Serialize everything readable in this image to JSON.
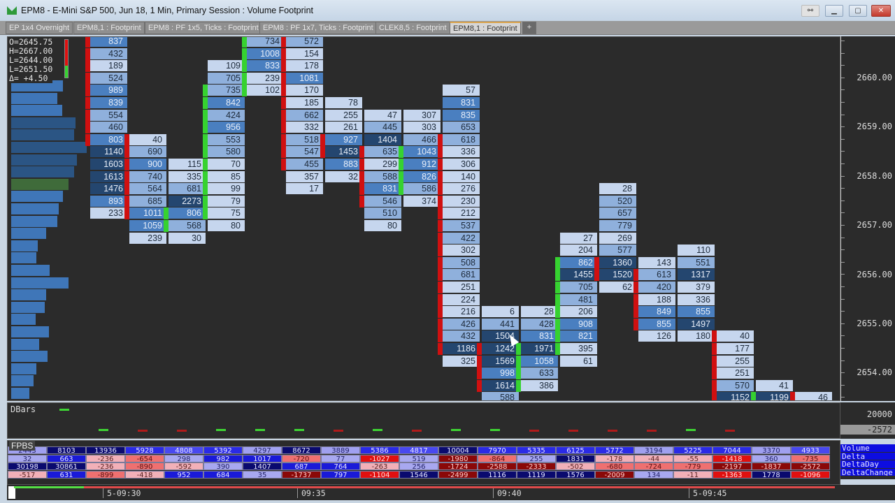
{
  "window": {
    "title": "EPM8 - E-Mini S&P 500, Jun 18, 1 Min, Primary Session : Volume Footprint",
    "buttons": [
      "link",
      "minimize",
      "maximize",
      "close"
    ]
  },
  "tabs": [
    {
      "label": "EP 1x4 Overnight",
      "active": false
    },
    {
      "label": "EPM8,1 : Footprint",
      "active": false
    },
    {
      "label": "EPM8 : PF 1x5, Ticks : Footprint",
      "active": false
    },
    {
      "label": "EPM8 : PF 1x7, Ticks : Footprint",
      "active": false
    },
    {
      "label": "CLEK8,5 : Footprint",
      "active": false
    },
    {
      "label": "EPM8,1 : Footprint",
      "active": true
    },
    {
      "label": "+",
      "active": false
    }
  ],
  "ohlc": {
    "open": "O=2645.75",
    "high": "H=2667.00",
    "low": "L=2644.00",
    "last": "L=2651.50",
    "change": "Δ=  +4.50"
  },
  "price_axis": [
    "2660.00",
    "2659.00",
    "2658.00",
    "2657.00",
    "2656.00",
    "2655.00",
    "2654.00"
  ],
  "colors": {
    "bg": "#2b2b2b",
    "up_marker": "#36d230",
    "down_marker": "#d01010",
    "cell_light": "#c6d6ee",
    "cell_mid": "#8fb0dc",
    "cell_blue": "#4a7fc0",
    "cell_dark": "#24466f"
  },
  "footprint": {
    "columns": [
      {
        "startRow": 0,
        "values": [
          837,
          432,
          189,
          524,
          989,
          839,
          554,
          460,
          803,
          1140,
          1603,
          1613,
          1476,
          893,
          233
        ],
        "marks": {
          "0": "down",
          "1": "down",
          "2": "down",
          "3": "down",
          "4": "down",
          "5": "down",
          "6": "down",
          "7": "down",
          "8": "down"
        }
      },
      {
        "startRow": 8,
        "values": [
          40,
          690,
          900,
          740,
          564,
          685,
          1011,
          1059,
          239
        ],
        "marks": {
          "8": "down",
          "9": "down",
          "10": "down",
          "11": "down",
          "12": "down",
          "13": "down",
          "14": "down"
        }
      },
      {
        "startRow": 10,
        "values": [
          115,
          335,
          681,
          2273,
          806,
          568,
          30
        ],
        "marks": {
          "14": "up",
          "15": "up"
        }
      },
      {
        "startRow": 2,
        "values": [
          109,
          705,
          735,
          842,
          424,
          956,
          553,
          580,
          70,
          85,
          99,
          79,
          75,
          80
        ],
        "marks": {
          "4": "up",
          "5": "up",
          "6": "up",
          "7": "up",
          "8": "up",
          "9": "up",
          "10": "up",
          "11": "up",
          "12": "up",
          "13": "up",
          "14": "up"
        }
      },
      {
        "startRow": 0,
        "values": [
          734,
          1008,
          833,
          239,
          102
        ],
        "marks": {
          "0": "up",
          "1": "up",
          "2": "up",
          "3": "up",
          "4": "up"
        }
      },
      {
        "startRow": 0,
        "values": [
          572,
          154,
          178,
          1081,
          170,
          185,
          662,
          332,
          518,
          547,
          455,
          357,
          17
        ],
        "marks": {
          "0": "down",
          "1": "down",
          "2": "down",
          "3": "down",
          "4": "down",
          "5": "down",
          "6": "down",
          "7": "down",
          "8": "down",
          "9": "down",
          "10": "down"
        }
      },
      {
        "startRow": 5,
        "values": [
          78,
          255,
          261,
          927,
          1453,
          883,
          32
        ],
        "marks": {
          "8": "down",
          "9": "down"
        }
      },
      {
        "startRow": 6,
        "values": [
          47,
          445,
          1404,
          635,
          299,
          588,
          831,
          546,
          510,
          80
        ],
        "marks": {
          "9": "down",
          "10": "down",
          "11": "down",
          "12": "down",
          "13": "down"
        }
      },
      {
        "startRow": 6,
        "values": [
          307,
          303,
          466,
          1043,
          912,
          826,
          586,
          374
        ],
        "marks": {
          "9": "up",
          "10": "up",
          "11": "up",
          "12": "up"
        }
      },
      {
        "startRow": 4,
        "values": [
          57,
          831,
          835,
          653,
          618,
          336,
          306,
          140,
          276,
          230,
          212,
          537,
          422,
          302,
          508,
          681,
          251,
          224,
          216,
          426,
          432,
          1186,
          325
        ],
        "marks": {
          "8": "down",
          "9": "down",
          "10": "down",
          "11": "down",
          "12": "down",
          "13": "down",
          "14": "down",
          "15": "down",
          "16": "down",
          "17": "down",
          "18": "down",
          "19": "down",
          "20": "down",
          "21": "down",
          "22": "down",
          "23": "down",
          "24": "down",
          "25": "down"
        }
      },
      {
        "startRow": 22,
        "values": [
          6,
          441,
          1504,
          1242,
          1569,
          998,
          1614,
          588
        ],
        "marks": {
          "25": "down",
          "26": "down",
          "27": "down",
          "28": "down"
        }
      },
      {
        "startRow": 22,
        "values": [
          28,
          428,
          831,
          1971,
          1058,
          633,
          386
        ],
        "marks": {
          "25": "up",
          "26": "up",
          "27": "up",
          "28": "up"
        }
      },
      {
        "startRow": 16,
        "values": [
          27,
          204,
          862,
          1455,
          705,
          481,
          206,
          908,
          821,
          395,
          61
        ],
        "marks": {
          "18": "up",
          "19": "up",
          "20": "up",
          "21": "up",
          "22": "up",
          "23": "up",
          "24": "up",
          "25": "up"
        }
      },
      {
        "startRow": 12,
        "values": [
          28,
          520,
          657,
          779,
          269,
          577,
          1360,
          1520,
          62
        ],
        "marks": {
          "18": "down",
          "19": "down"
        }
      },
      {
        "startRow": 18,
        "values": [
          143,
          613,
          420,
          188,
          849,
          855,
          126
        ],
        "marks": {
          "19": "down",
          "20": "down",
          "21": "down",
          "22": "down",
          "23": "down"
        }
      },
      {
        "startRow": 17,
        "values": [
          110,
          551,
          1317,
          379,
          336,
          855,
          1497,
          180
        ],
        "marks": {}
      },
      {
        "startRow": 24,
        "values": [
          40,
          177,
          255,
          251,
          570,
          1152
        ],
        "marks": {
          "24": "down",
          "25": "down",
          "26": "down",
          "27": "down",
          "28": "down",
          "29": "down"
        }
      },
      {
        "startRow": 28,
        "values": [
          41,
          1199
        ],
        "marks": {
          "29": "up"
        }
      },
      {
        "startRow": 29,
        "values": [
          46
        ],
        "marks": {
          "29": "down"
        }
      }
    ]
  },
  "volume_profile": [
    0.62,
    0.55,
    0.61,
    0.77,
    0.75,
    0.9,
    0.78,
    0.75,
    0.68,
    0.62,
    0.57,
    0.55,
    0.42,
    0.32,
    0.3,
    0.46,
    0.68,
    0.42,
    0.4,
    0.29,
    0.45,
    0.33,
    0.43,
    0.3,
    0.27,
    0.22
  ],
  "dbars": {
    "title": "DBars",
    "axis_top": "20000",
    "axis_current": "-2572",
    "bars": [
      "up",
      "down",
      "down",
      "up",
      "up",
      "up",
      "down",
      "up",
      "down",
      "up",
      "up",
      "down",
      "down",
      "down",
      "down",
      "up",
      "down"
    ]
  },
  "fpbs": {
    "title": "FPBS",
    "legend": [
      "Volume",
      "Delta",
      "DeltaDay",
      "DeltaChange"
    ],
    "volume": [
      2443,
      8103,
      13936,
      5928,
      4808,
      5392,
      4297,
      8672,
      3889,
      5386,
      4817,
      10004,
      7970,
      5335,
      6125,
      5772,
      3194,
      5225,
      7044,
      3370,
      4933
    ],
    "delta": [
      32,
      663,
      -236,
      -654,
      298,
      982,
      1017,
      -720,
      77,
      -1027,
      519,
      -1980,
      -864,
      255,
      1831,
      -178,
      -44,
      -55,
      -1418,
      360,
      -735
    ],
    "delta_day": [
      30198,
      30861,
      -236,
      -890,
      -592,
      390,
      1407,
      687,
      764,
      -263,
      256,
      -1724,
      -2588,
      -2333,
      -502,
      -680,
      -724,
      -779,
      -2197,
      -1837,
      -2572
    ],
    "delta_change": [
      -517,
      631,
      -899,
      -418,
      952,
      684,
      35,
      -1737,
      797,
      -1104,
      1546,
      -2499,
      1116,
      1119,
      1576,
      -2009,
      134,
      -11,
      -1363,
      1778,
      -1096
    ]
  },
  "time_axis": [
    "5-09:30",
    "09:35",
    "09:40",
    "5-09:45"
  ]
}
